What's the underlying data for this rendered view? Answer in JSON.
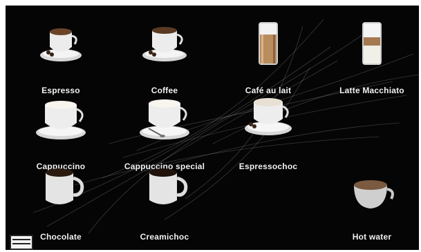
{
  "screen_title": "",
  "drinks": [
    {
      "id": "espresso",
      "label": "Espresso",
      "icon": "espresso-cup-icon"
    },
    {
      "id": "coffee",
      "label": "Coffee",
      "icon": "coffee-cup-icon"
    },
    {
      "id": "cafe-au-lait",
      "label": "Café au lait",
      "icon": "latte-glass-icon"
    },
    {
      "id": "latte-macchiato",
      "label": "Latte Macchiato",
      "icon": "layered-glass-icon"
    },
    {
      "id": "cappuccino",
      "label": "Cappuccino",
      "icon": "cappuccino-cup-icon"
    },
    {
      "id": "cappuccino-special",
      "label": "Cappuccino special",
      "icon": "cappuccino-spoon-cup-icon"
    },
    {
      "id": "espressochoc",
      "label": "Espressochoc",
      "icon": "choc-cup-icon"
    },
    {
      "id": "chocolate",
      "label": "Chocolate",
      "icon": "chocolate-mug-icon"
    },
    {
      "id": "creamichoc",
      "label": "Creamichoc",
      "icon": "creamichoc-mug-icon"
    },
    {
      "id": "hot-water",
      "label": "Hot water",
      "icon": "hot-water-bowl-icon"
    }
  ],
  "menu_icon": "menu-icon",
  "colors": {
    "background": "#050505",
    "label": "#f2f2f2"
  }
}
